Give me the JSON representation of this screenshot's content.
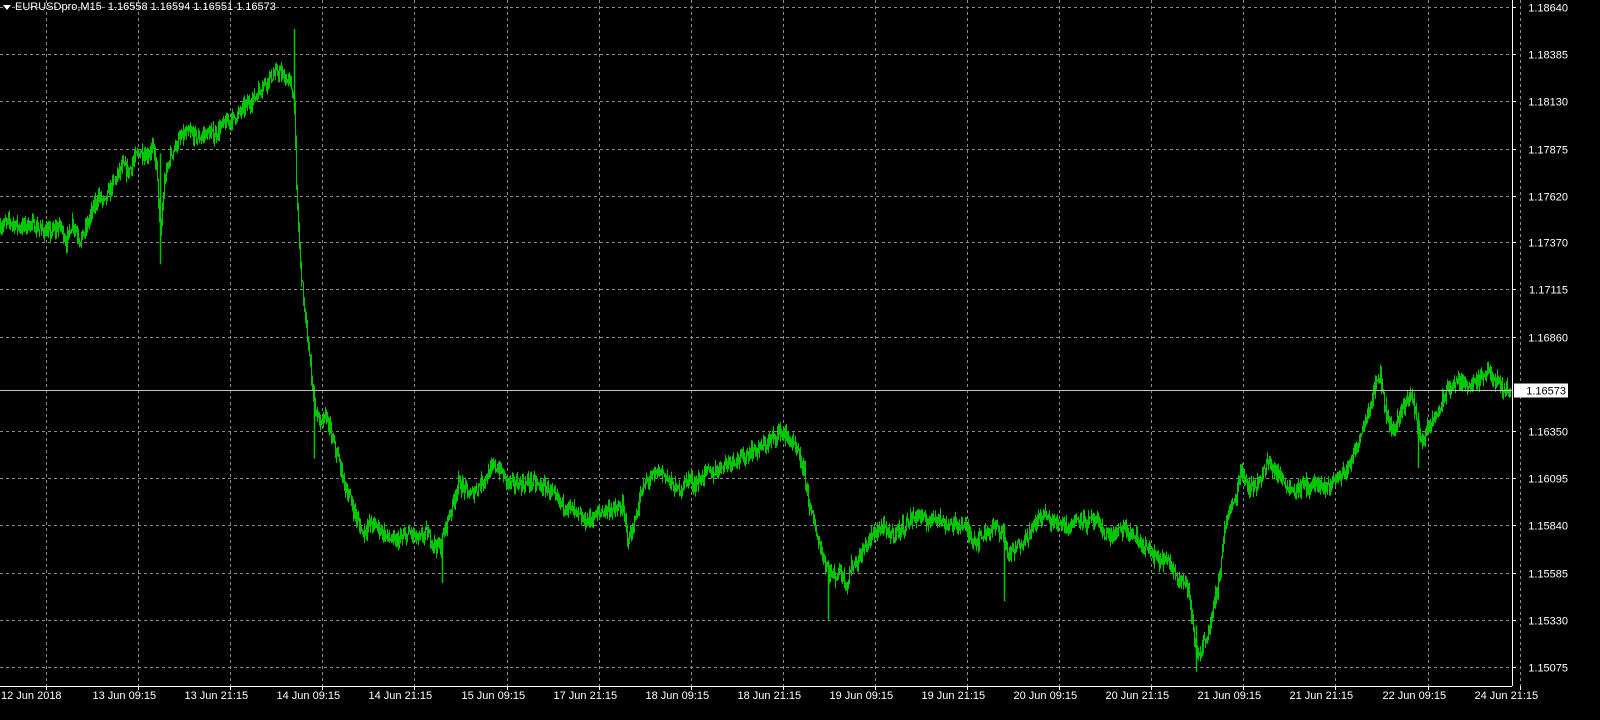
{
  "header": {
    "symbol_timeframe": "EURUSDpro,M15",
    "open": "1.16558",
    "high": "1.16594",
    "low": "1.16551",
    "close": "1.16573"
  },
  "colors": {
    "background": "#000000",
    "grid": "#8a8a8a",
    "bars": "#00c800",
    "axis": "#ffffff",
    "current_price_line": "#c0c0c0"
  },
  "chart_data": {
    "type": "line",
    "style": "bar-ohlc",
    "grid": true,
    "current_price": "1.16573",
    "ylim": [
      1.1495,
      1.1864
    ],
    "y_ticks": [
      "1.18640",
      "1.18385",
      "1.18130",
      "1.17875",
      "1.17620",
      "1.17370",
      "1.17115",
      "1.16860",
      "1.16350",
      "1.16095",
      "1.15840",
      "1.15585",
      "1.15330",
      "1.15075"
    ],
    "x_ticks": [
      "12 Jun 2018",
      "13 Jun 09:15",
      "13 Jun 21:15",
      "14 Jun 09:15",
      "14 Jun 21:15",
      "15 Jun 09:15",
      "17 Jun 21:15",
      "18 Jun 09:15",
      "18 Jun 21:15",
      "19 Jun 09:15",
      "19 Jun 21:15",
      "20 Jun 09:15",
      "20 Jun 21:15",
      "21 Jun 09:15",
      "21 Jun 21:15",
      "22 Jun 09:15",
      "24 Jun 21:15"
    ],
    "series": [
      {
        "values": [
          [
            0,
            1.1746
          ],
          [
            10,
            1.1748
          ],
          [
            20,
            1.1745
          ],
          [
            30,
            1.1747
          ],
          [
            40,
            1.1744
          ],
          [
            50,
            1.1742
          ],
          [
            60,
            1.1746
          ],
          [
            66,
            1.1737
          ],
          [
            72,
            1.1748
          ],
          [
            80,
            1.1738
          ],
          [
            86,
            1.1745
          ],
          [
            92,
            1.1754
          ],
          [
            98,
            1.1762
          ],
          [
            104,
            1.1758
          ],
          [
            110,
            1.1766
          ],
          [
            116,
            1.1772
          ],
          [
            122,
            1.1778
          ],
          [
            128,
            1.1775
          ],
          [
            134,
            1.1782
          ],
          [
            140,
            1.1786
          ],
          [
            146,
            1.1784
          ],
          [
            152,
            1.1788
          ],
          [
            156,
            1.1779
          ],
          [
            160,
            1.174
          ],
          [
            164,
            1.177
          ],
          [
            170,
            1.1784
          ],
          [
            176,
            1.179
          ],
          [
            182,
            1.1794
          ],
          [
            190,
            1.1796
          ],
          [
            198,
            1.1793
          ],
          [
            206,
            1.1796
          ],
          [
            214,
            1.1795
          ],
          [
            222,
            1.18
          ],
          [
            230,
            1.1803
          ],
          [
            238,
            1.1806
          ],
          [
            246,
            1.1811
          ],
          [
            254,
            1.1815
          ],
          [
            262,
            1.1822
          ],
          [
            270,
            1.1826
          ],
          [
            278,
            1.1829
          ],
          [
            284,
            1.1826
          ],
          [
            290,
            1.1823
          ],
          [
            294,
            1.1812
          ],
          [
            296,
            1.1765
          ],
          [
            300,
            1.1725
          ],
          [
            304,
            1.17
          ],
          [
            308,
            1.168
          ],
          [
            314,
            1.165
          ],
          [
            320,
            1.1638
          ],
          [
            326,
            1.1643
          ],
          [
            332,
            1.163
          ],
          [
            338,
            1.162
          ],
          [
            344,
            1.1606
          ],
          [
            350,
            1.1598
          ],
          [
            356,
            1.1588
          ],
          [
            362,
            1.158
          ],
          [
            370,
            1.1585
          ],
          [
            378,
            1.1583
          ],
          [
            386,
            1.1578
          ],
          [
            394,
            1.1575
          ],
          [
            402,
            1.1577
          ],
          [
            410,
            1.158
          ],
          [
            418,
            1.1576
          ],
          [
            426,
            1.158
          ],
          [
            434,
            1.1574
          ],
          [
            440,
            1.1572
          ],
          [
            446,
            1.1585
          ],
          [
            452,
            1.1595
          ],
          [
            458,
            1.1607
          ],
          [
            464,
            1.1604
          ],
          [
            470,
            1.16
          ],
          [
            476,
            1.1604
          ],
          [
            482,
            1.1608
          ],
          [
            488,
            1.1612
          ],
          [
            494,
            1.1616
          ],
          [
            500,
            1.1614
          ],
          [
            506,
            1.1608
          ],
          [
            512,
            1.1606
          ],
          [
            518,
            1.1607
          ],
          [
            524,
            1.1606
          ],
          [
            530,
            1.1608
          ],
          [
            540,
            1.1605
          ],
          [
            548,
            1.1604
          ],
          [
            554,
            1.1599
          ],
          [
            560,
            1.1596
          ],
          [
            568,
            1.1594
          ],
          [
            576,
            1.159
          ],
          [
            584,
            1.1586
          ],
          [
            592,
            1.1588
          ],
          [
            600,
            1.1591
          ],
          [
            608,
            1.1593
          ],
          [
            616,
            1.1592
          ],
          [
            622,
            1.1594
          ],
          [
            628,
            1.1576
          ],
          [
            634,
            1.1585
          ],
          [
            640,
            1.16
          ],
          [
            646,
            1.1608
          ],
          [
            652,
            1.161
          ],
          [
            658,
            1.1613
          ],
          [
            664,
            1.1612
          ],
          [
            670,
            1.1607
          ],
          [
            676,
            1.1603
          ],
          [
            682,
            1.1605
          ],
          [
            688,
            1.161
          ],
          [
            694,
            1.1606
          ],
          [
            700,
            1.1609
          ],
          [
            706,
            1.1613
          ],
          [
            712,
            1.1612
          ],
          [
            718,
            1.1615
          ],
          [
            726,
            1.1618
          ],
          [
            734,
            1.162
          ],
          [
            742,
            1.162
          ],
          [
            750,
            1.1624
          ],
          [
            758,
            1.1625
          ],
          [
            766,
            1.1628
          ],
          [
            774,
            1.1632
          ],
          [
            780,
            1.1635
          ],
          [
            786,
            1.1632
          ],
          [
            792,
            1.1628
          ],
          [
            798,
            1.1622
          ],
          [
            804,
            1.1612
          ],
          [
            810,
            1.1592
          ],
          [
            816,
            1.158
          ],
          [
            822,
            1.1568
          ],
          [
            828,
            1.156
          ],
          [
            834,
            1.1556
          ],
          [
            840,
            1.156
          ],
          [
            846,
            1.1552
          ],
          [
            852,
            1.1563
          ],
          [
            858,
            1.1565
          ],
          [
            864,
            1.1572
          ],
          [
            870,
            1.1577
          ],
          [
            876,
            1.1581
          ],
          [
            882,
            1.1583
          ],
          [
            888,
            1.1579
          ],
          [
            894,
            1.158
          ],
          [
            900,
            1.1582
          ],
          [
            906,
            1.1585
          ],
          [
            912,
            1.1588
          ],
          [
            918,
            1.159
          ],
          [
            924,
            1.1586
          ],
          [
            930,
            1.1587
          ],
          [
            936,
            1.159
          ],
          [
            942,
            1.1585
          ],
          [
            948,
            1.1585
          ],
          [
            954,
            1.1584
          ],
          [
            960,
            1.1585
          ],
          [
            966,
            1.1582
          ],
          [
            972,
            1.1577
          ],
          [
            978,
            1.1576
          ],
          [
            984,
            1.158
          ],
          [
            990,
            1.1582
          ],
          [
            996,
            1.1583
          ],
          [
            1002,
            1.158
          ],
          [
            1008,
            1.1568
          ],
          [
            1014,
            1.157
          ],
          [
            1020,
            1.1575
          ],
          [
            1026,
            1.1578
          ],
          [
            1032,
            1.1582
          ],
          [
            1038,
            1.1588
          ],
          [
            1044,
            1.159
          ],
          [
            1050,
            1.1586
          ],
          [
            1056,
            1.1585
          ],
          [
            1062,
            1.1586
          ],
          [
            1068,
            1.1583
          ],
          [
            1074,
            1.1586
          ],
          [
            1080,
            1.1589
          ],
          [
            1086,
            1.1585
          ],
          [
            1092,
            1.1587
          ],
          [
            1098,
            1.1584
          ],
          [
            1104,
            1.158
          ],
          [
            1110,
            1.1578
          ],
          [
            1116,
            1.158
          ],
          [
            1122,
            1.1582
          ],
          [
            1128,
            1.158
          ],
          [
            1134,
            1.1578
          ],
          [
            1140,
            1.1574
          ],
          [
            1146,
            1.1572
          ],
          [
            1152,
            1.1568
          ],
          [
            1158,
            1.1565
          ],
          [
            1164,
            1.1566
          ],
          [
            1170,
            1.1562
          ],
          [
            1176,
            1.1558
          ],
          [
            1182,
            1.1555
          ],
          [
            1188,
            1.155
          ],
          [
            1192,
            1.153
          ],
          [
            1196,
            1.1515
          ],
          [
            1200,
            1.1515
          ],
          [
            1204,
            1.1522
          ],
          [
            1208,
            1.1527
          ],
          [
            1212,
            1.1535
          ],
          [
            1216,
            1.1548
          ],
          [
            1220,
            1.156
          ],
          [
            1224,
            1.1583
          ],
          [
            1228,
            1.159
          ],
          [
            1232,
            1.1595
          ],
          [
            1236,
            1.16
          ],
          [
            1240,
            1.1615
          ],
          [
            1244,
            1.161
          ],
          [
            1250,
            1.1604
          ],
          [
            1256,
            1.1606
          ],
          [
            1262,
            1.1612
          ],
          [
            1268,
            1.1618
          ],
          [
            1274,
            1.1614
          ],
          [
            1280,
            1.161
          ],
          [
            1286,
            1.1606
          ],
          [
            1292,
            1.1603
          ],
          [
            1298,
            1.1604
          ],
          [
            1304,
            1.1606
          ],
          [
            1310,
            1.1605
          ],
          [
            1316,
            1.1607
          ],
          [
            1322,
            1.1603
          ],
          [
            1328,
            1.1605
          ],
          [
            1334,
            1.1609
          ],
          [
            1340,
            1.1611
          ],
          [
            1346,
            1.1614
          ],
          [
            1352,
            1.162
          ],
          [
            1358,
            1.163
          ],
          [
            1364,
            1.164
          ],
          [
            1370,
            1.165
          ],
          [
            1376,
            1.1662
          ],
          [
            1380,
            1.1665
          ],
          [
            1384,
            1.165
          ],
          [
            1388,
            1.164
          ],
          [
            1392,
            1.1635
          ],
          [
            1398,
            1.1642
          ],
          [
            1404,
            1.165
          ],
          [
            1410,
            1.1654
          ],
          [
            1414,
            1.1648
          ],
          [
            1418,
            1.1635
          ],
          [
            1422,
            1.163
          ],
          [
            1428,
            1.1636
          ],
          [
            1434,
            1.1642
          ],
          [
            1440,
            1.1648
          ],
          [
            1446,
            1.1656
          ],
          [
            1452,
            1.166
          ],
          [
            1458,
            1.1662
          ],
          [
            1464,
            1.166
          ],
          [
            1470,
            1.1661
          ],
          [
            1476,
            1.166
          ],
          [
            1482,
            1.1664
          ],
          [
            1488,
            1.1667
          ],
          [
            1494,
            1.1662
          ],
          [
            1500,
            1.166
          ],
          [
            1506,
            1.1657
          ],
          [
            1510,
            1.1657
          ]
        ]
      }
    ]
  }
}
